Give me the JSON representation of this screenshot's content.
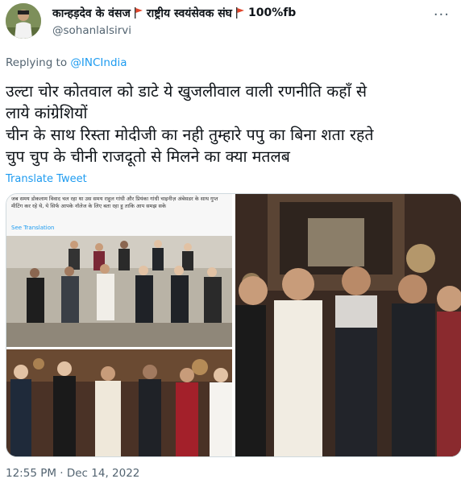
{
  "tweet": {
    "display_name": "कान्हड़देव के वंसज",
    "display_name_rest": "राष्ट्रीय स्वयंसेवक संघ",
    "display_name_tail": "100%fb",
    "handle": "@sohanlalsirvi",
    "more_label": "···",
    "replying_prefix": "Replying to",
    "replying_to": "@INCIndia",
    "text_lines": [
      "उल्टा चोर कोतवाल को डाटे ये खुजलीवाल वाली रणनीति कहाँ से",
      "लाये कांग्रेशियों",
      "चीन के साथ रिस्ता मोदीजी का नही तुम्हारे पपु का बिना शता रहते",
      "चुप चुप के चीनी राजदूतो से मिलने का क्या मतलब"
    ],
    "translate_label": "Translate Tweet",
    "timestamp": "12:55 PM · Dec 14, 2022"
  },
  "media": {
    "clip_caption": "जब समय डोकलाम विवाद चल रहा था उस समय राहुल गांधी और प्रियंका गांधी चाइनीज़ अंबेसडर के साथ गुप्त मीटिंग कर रहे थे, ये सिर्फ आपके नॉलेज के लिए बता रहा हु ताकि आप समझ सके",
    "clip_translate": "See Translation"
  },
  "colors": {
    "accent": "#1d9bf0",
    "secondary_text": "#536471",
    "flag": "#e0452b"
  }
}
